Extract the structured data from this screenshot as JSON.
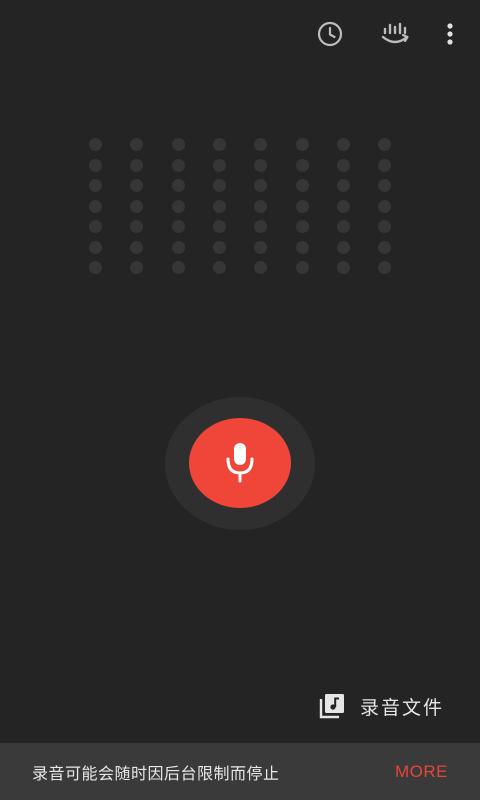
{
  "toolbar": {
    "icons": [
      "history-icon",
      "voice-sync-icon",
      "more-vert-icon"
    ]
  },
  "visualizer": {
    "columns": 8,
    "rows": 7
  },
  "recorder": {
    "icon": "microphone-icon",
    "accent_color": "#f0463a"
  },
  "files": {
    "icon": "music-library-icon",
    "label": "录音文件"
  },
  "snackbar": {
    "message": "录音可能会随时因后台限制而停止",
    "action": "MORE",
    "action_color": "#e5453c"
  }
}
